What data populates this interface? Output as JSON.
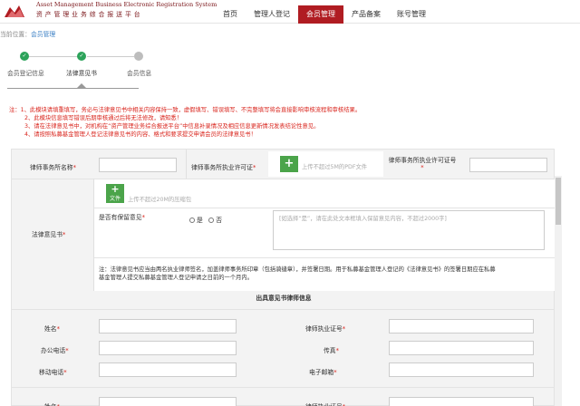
{
  "header": {
    "logo_en": "Asset Management Business Electronic Registration System",
    "logo_cn": "资产管理业务综合报送平台",
    "nav": [
      "首页",
      "管理人登记",
      "会员管理",
      "产品备案",
      "账号管理"
    ],
    "active_index": 2,
    "brand_color": "#b01c22"
  },
  "breadcrumb": {
    "prefix": "当前位置：",
    "link": "会员管理"
  },
  "steps": [
    {
      "label": "会员登记信息",
      "done": true
    },
    {
      "label": "法律意见书",
      "done": true
    },
    {
      "label": "会员信息",
      "done": false
    }
  ],
  "notes": [
    "注：1、此模块请填重填写，务必与法律意见书中相关内容保持一致，虚假填写、错误填写、不完整填写将会直接影响审核流程和审核结果。",
    "2、此模块信息填写错误后期审核通过后将无法修改，请知悉！",
    "3、请在法律意见书中，对机构在“资产管理业务综合报送平台”中信息补录情况及相应信息更新情况发表结论性意见。",
    "4、请按照私募基金管理人登记法律意见书的内容、格式和要求提交申请会员的法律意见书！"
  ],
  "form": {
    "firm_name_label": "律师事务所名称",
    "firm_license_label": "律师事务所执业许可证",
    "firm_license_hint": "上传不超过5M的PDF文件",
    "firm_license_no_label": "律师事务所执业许可证号",
    "file_button": "文件",
    "file_hint": "上传不超过20M的压缩包",
    "opinion_label": "法律意见书",
    "reservation_label": "是否有保留意见",
    "yes": "是",
    "no": "否",
    "reservation_placeholder": "[如选择“是”，请在此处文本框填入保留意见内容，不超过2000字]",
    "opinion_note_1": "注：法律意见书应当由两名执业律师签名，加盖律师事务所印章（包括骑缝章），并签署日期。用于私募基金管理人登记的《法律意见书》的签署日期应在私募",
    "opinion_note_2": "基金管理人提交私募基金管理人登记申请之日前的一个月内。",
    "section_title": "出具意见书律师信息",
    "name_label": "姓名",
    "license_no_label": "律师执业证号",
    "office_phone_label": "办公电话",
    "fax_label": "传真",
    "mobile_label": "移动电话",
    "email_label": "电子邮箱"
  }
}
